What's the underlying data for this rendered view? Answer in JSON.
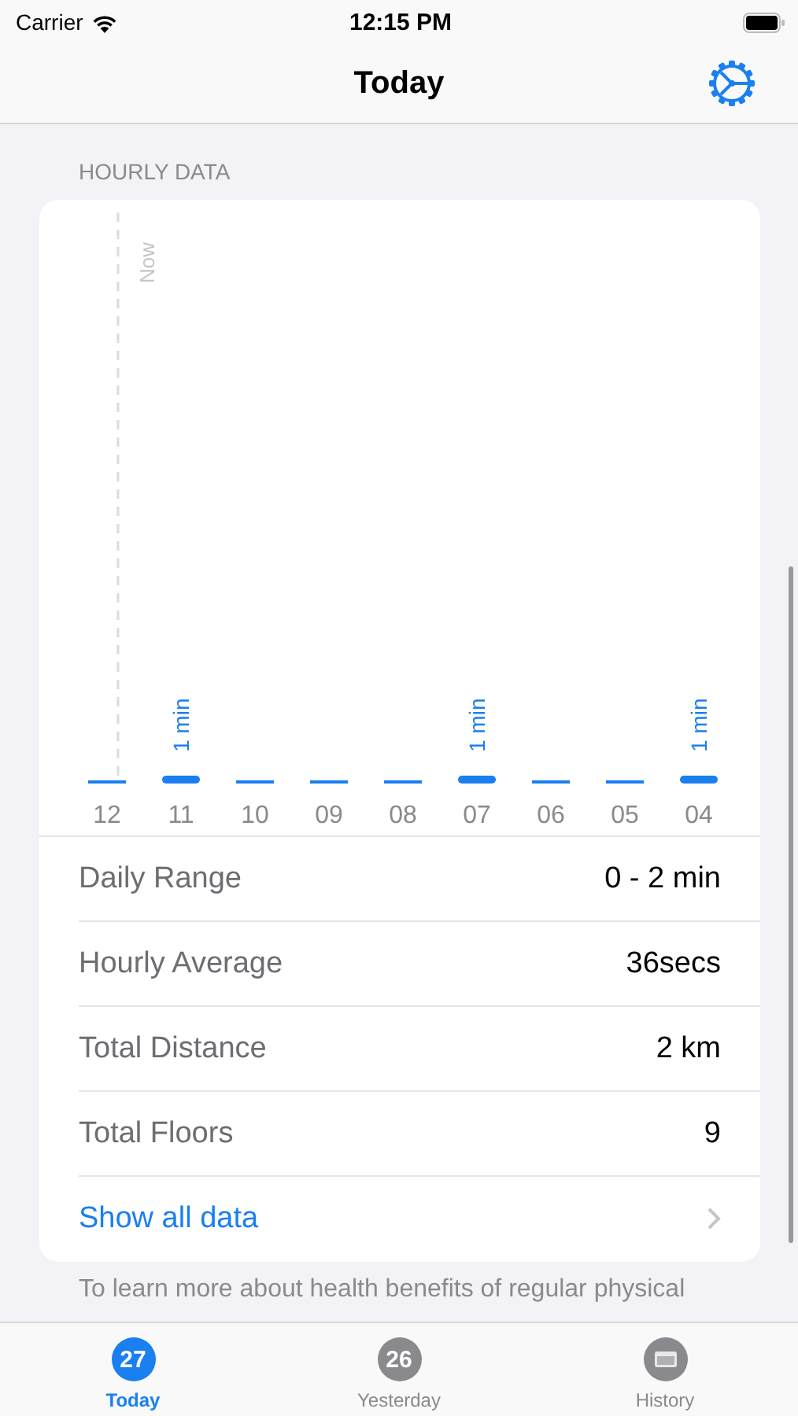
{
  "status_bar": {
    "carrier": "Carrier",
    "time": "12:15 PM"
  },
  "nav": {
    "title": "Today"
  },
  "section_header": "HOURLY DATA",
  "hourly": {
    "chart_data": {
      "type": "bar",
      "categories": [
        "12",
        "11",
        "10",
        "09",
        "08",
        "07",
        "06",
        "05",
        "04"
      ],
      "values": [
        0,
        1,
        0,
        0,
        0,
        1,
        0,
        0,
        1
      ],
      "value_labels": [
        null,
        "1 min",
        null,
        null,
        null,
        "1 min",
        null,
        null,
        "1 min"
      ],
      "ref_lines": [
        {
          "axis": "x",
          "value": "12",
          "label": "Now"
        }
      ]
    }
  },
  "stats": [
    {
      "label": "Daily Range",
      "value": "0 - 2 min"
    },
    {
      "label": "Hourly Average",
      "value": "36secs"
    },
    {
      "label": "Total Distance",
      "value": "2 km"
    },
    {
      "label": "Total Floors",
      "value": "9"
    }
  ],
  "show_all": {
    "label": "Show all data"
  },
  "footnote": "To learn more about health benefits of regular physical",
  "tabs": [
    {
      "label": "Today",
      "badge": "27",
      "kind": "date",
      "selected": true
    },
    {
      "label": "Yesterday",
      "badge": "26",
      "kind": "date",
      "selected": false
    },
    {
      "label": "History",
      "kind": "calendar",
      "selected": false
    }
  ]
}
